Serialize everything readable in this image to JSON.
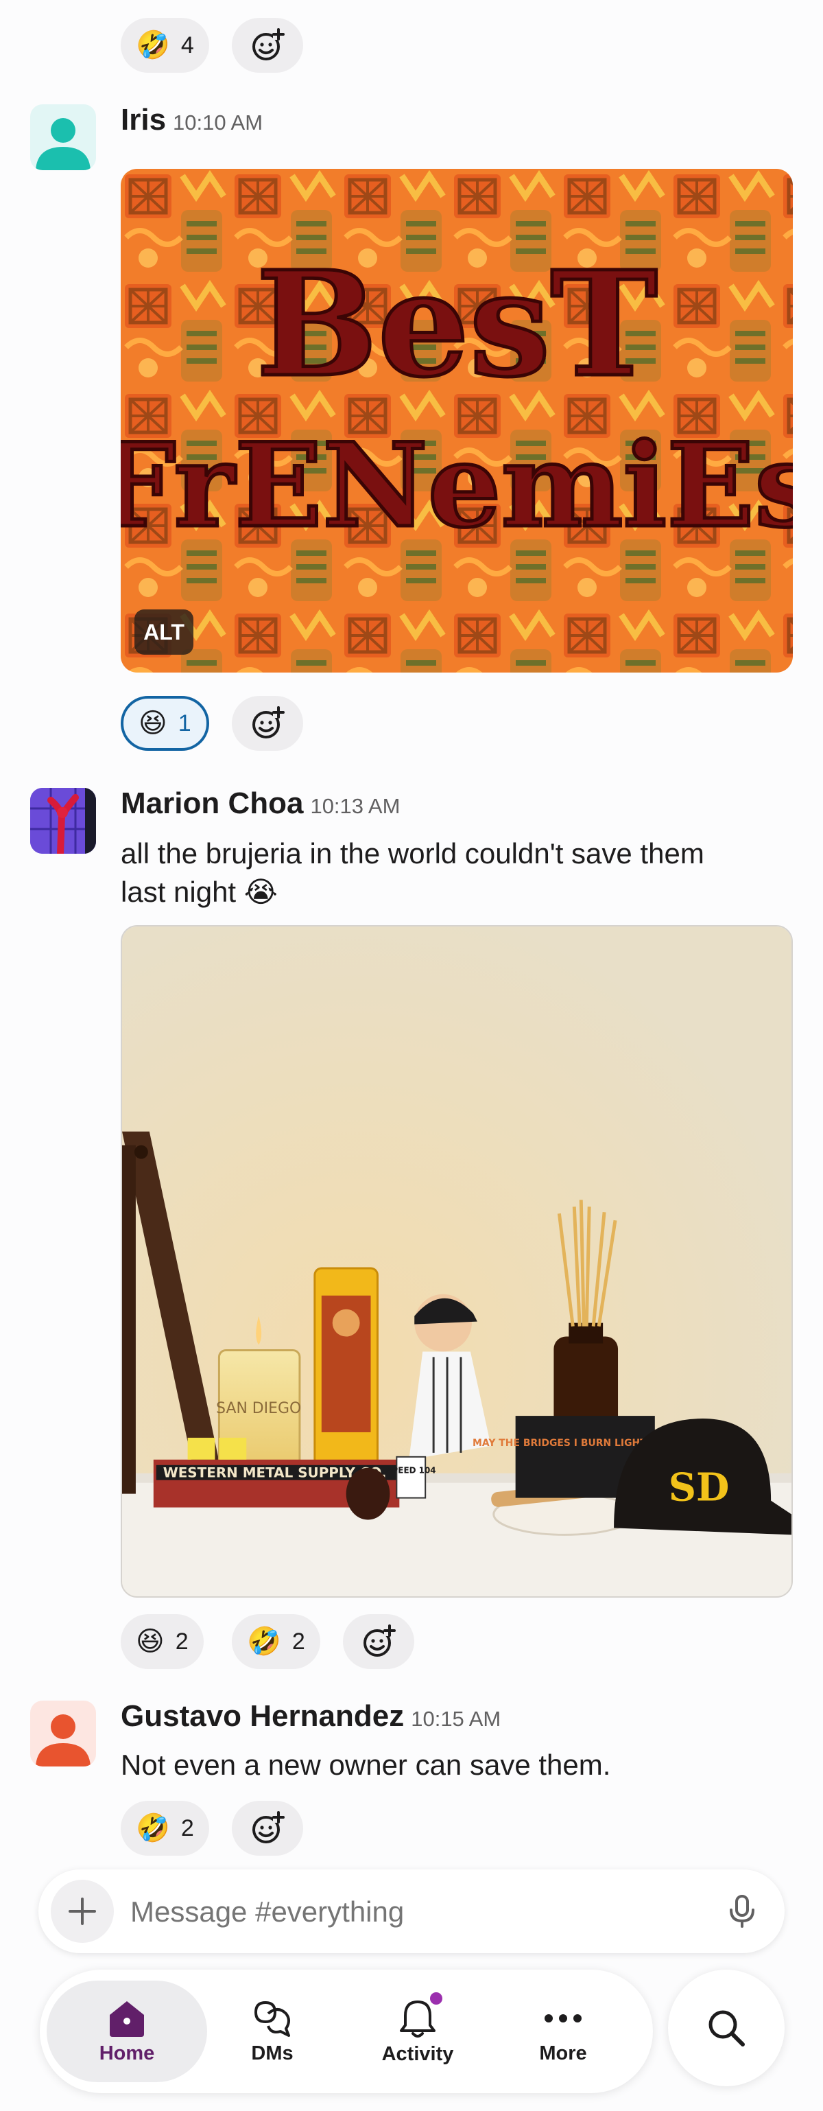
{
  "top_reactions": [
    {
      "emoji": "🤣",
      "count": "4"
    }
  ],
  "messages": [
    {
      "author": "Iris",
      "time": "10:10 AM",
      "image": {
        "title_line1": "BesT",
        "title_line2": "FrENemiEs",
        "alt_badge": "ALT"
      },
      "reactions": [
        {
          "emoji": "😆",
          "count": "1"
        }
      ]
    },
    {
      "author": "Marion Choa",
      "time": "10:13 AM",
      "text_line1": "all the brujeria in the world couldn't save them",
      "text_line2": "last night 😭",
      "photo": {
        "candle_label": "SAN DIEGO",
        "book_label": "WESTERN METAL SUPPLY CO.",
        "card_label": "MAY THE BRIDGES I BURN LIGHT THE WAY",
        "sign_label": "SPEED 104",
        "helmet_logo": "SD"
      },
      "reactions": [
        {
          "emoji": "😆",
          "count": "2"
        },
        {
          "emoji": "🤣",
          "count": "2"
        }
      ]
    },
    {
      "author": "Gustavo Hernandez",
      "time": "10:15 AM",
      "text": "Not even a new owner can save them.",
      "reactions": [
        {
          "emoji": "🤣",
          "count": "2"
        }
      ]
    }
  ],
  "composer": {
    "placeholder": "Message #everything"
  },
  "tabs": [
    {
      "label": "Home",
      "active": true
    },
    {
      "label": "DMs"
    },
    {
      "label": "Activity",
      "badge": true
    },
    {
      "label": "More"
    }
  ],
  "colors": {
    "accent": "#1264a3",
    "home_active": "#611f69",
    "activity_dot": "#9b2fae"
  }
}
